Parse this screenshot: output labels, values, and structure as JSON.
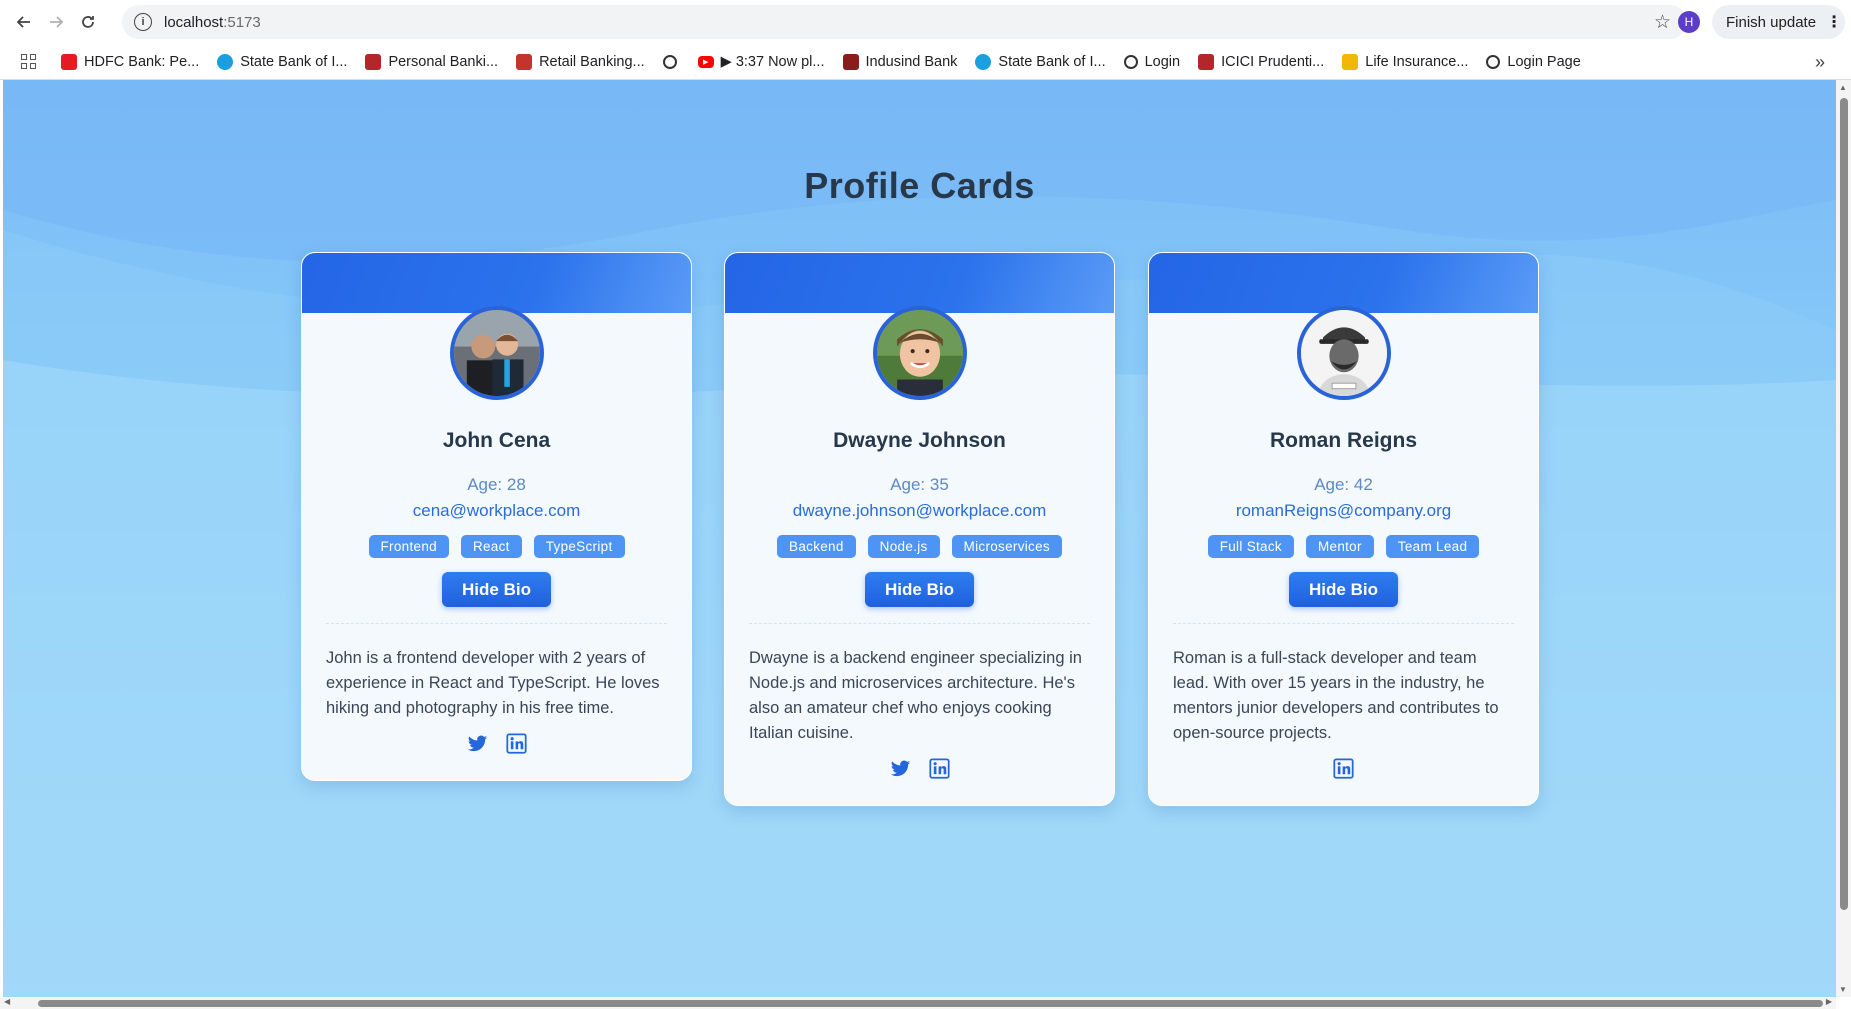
{
  "browser": {
    "url_host": "localhost",
    "url_port": ":5173",
    "profile_initial": "H",
    "finish_update_label": "Finish update",
    "bookmarks": [
      {
        "label": "HDFC Bank: Pe...",
        "icon": "hdfc-icon",
        "color": "#e41b23"
      },
      {
        "label": "State Bank of I...",
        "icon": "sbi-icon",
        "color": "#1a9fe0"
      },
      {
        "label": "Personal Banki...",
        "icon": "icici-icon",
        "color": "#b3262a"
      },
      {
        "label": "Retail Banking...",
        "icon": "axis-icon",
        "color": "#c4342d"
      },
      {
        "label": "",
        "icon": "globe-icon",
        "color": "#333333"
      },
      {
        "label": "▶ 3:37 Now pl...",
        "icon": "youtube-icon",
        "color": "#ff0000"
      },
      {
        "label": "Indusind Bank",
        "icon": "indusind-icon",
        "color": "#8b1c1c"
      },
      {
        "label": "State Bank of I...",
        "icon": "sbi-icon",
        "color": "#1a9fe0"
      },
      {
        "label": "Login",
        "icon": "globe-icon",
        "color": "#333333"
      },
      {
        "label": "ICICI Prudenti...",
        "icon": "icici-icon",
        "color": "#b3262a"
      },
      {
        "label": "Life Insurance...",
        "icon": "lic-icon",
        "color": "#f2b705"
      },
      {
        "label": "Login Page",
        "icon": "globe-icon",
        "color": "#333333"
      }
    ]
  },
  "page": {
    "title": "Profile Cards",
    "colors": {
      "accent": "#2566dc",
      "tag": "#4e94f5",
      "banner": "#2466e6",
      "title": "#27384a"
    },
    "cards": [
      {
        "name": "John Cena",
        "age": "Age: 28",
        "email": "cena@workplace.com",
        "tags": [
          "Frontend",
          "React",
          "TypeScript"
        ],
        "bio_button": "Hide Bio",
        "bio": "John is a frontend developer with 2 years of experience in React and TypeScript. He loves hiking and photography in his free time.",
        "socials": [
          "twitter-icon",
          "linkedin-icon"
        ]
      },
      {
        "name": "Dwayne Johnson",
        "age": "Age: 35",
        "email": "dwayne.johnson@workplace.com",
        "tags": [
          "Backend",
          "Node.js",
          "Microservices"
        ],
        "bio_button": "Hide Bio",
        "bio": "Dwayne is a backend engineer specializing in Node.js and microservices architecture. He's also an amateur chef who enjoys cooking Italian cuisine.",
        "socials": [
          "twitter-icon",
          "linkedin-icon"
        ]
      },
      {
        "name": "Roman Reigns",
        "age": "Age: 42",
        "email": "romanReigns@company.org",
        "tags": [
          "Full Stack",
          "Mentor",
          "Team Lead"
        ],
        "bio_button": "Hide Bio",
        "bio": "Roman is a full-stack developer and team lead. With over 15 years in the industry, he mentors junior developers and contributes to open-source projects.",
        "socials": [
          "linkedin-icon"
        ]
      }
    ]
  }
}
